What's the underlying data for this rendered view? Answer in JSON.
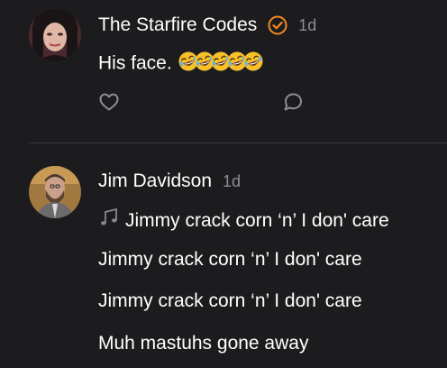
{
  "posts": [
    {
      "author": "The Starfire Codes",
      "time": "1d",
      "verified_badge_color": "#f58a21",
      "text": "His face.",
      "emoji": "rolling-on-floor-laughing",
      "emoji_count": 5,
      "actions": [
        "heart-icon",
        "comment-icon"
      ]
    },
    {
      "author": "Jim Davidson",
      "time": "1d",
      "lines": [
        "Jimmy crack corn ‘n’ I don' care",
        "Jimmy crack corn ‘n’ I don' care",
        "Jimmy crack corn ‘n’ I don' care",
        "Muh mastuhs gone away"
      ],
      "line1_prefix_icon": "music-notes-icon"
    }
  ],
  "colors": {
    "background": "#1c1c1e",
    "secondary_text": "#8e8e93",
    "divider": "#38383a"
  }
}
